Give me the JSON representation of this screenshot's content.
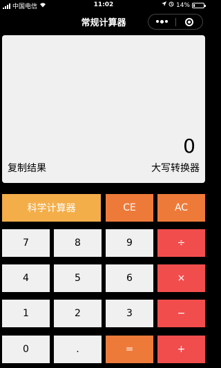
{
  "status_bar": {
    "carrier": "中国电信",
    "time": "11:02",
    "battery": "14%",
    "battery_level": 0.14
  },
  "nav": {
    "title": "常规计算器"
  },
  "display": {
    "value": "0",
    "copy_label": "复制结果",
    "convert_label": "大写转换器"
  },
  "keys": {
    "scientific": "科学计算器",
    "ce": "CE",
    "ac": "AC",
    "d7": "7",
    "d8": "8",
    "d9": "9",
    "divide": "÷",
    "d4": "4",
    "d5": "5",
    "d6": "6",
    "multiply": "×",
    "d1": "1",
    "d2": "2",
    "d3": "3",
    "minus": "−",
    "d0": "0",
    "dot": ".",
    "equals": "=",
    "plus": "+"
  },
  "colors": {
    "orange": "#ee7a3a",
    "yellow": "#f3ae4a",
    "red": "#f24d4d",
    "light": "#f0f0f0"
  }
}
